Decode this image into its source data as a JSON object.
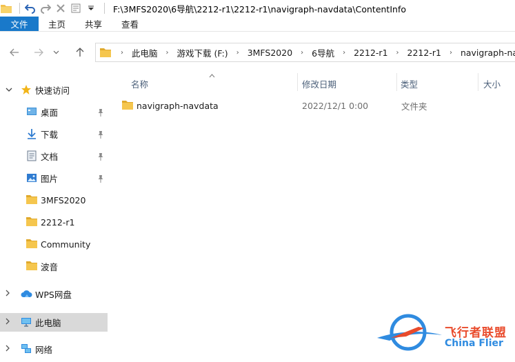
{
  "window": {
    "title": "F:\\3MFS2020\\6导航\\2212-r1\\2212-r1\\navigraph-navdata\\ContentInfo"
  },
  "ribbon": {
    "tabs": [
      "文件",
      "主页",
      "共享",
      "查看"
    ]
  },
  "address": {
    "crumbs": [
      "此电脑",
      "游戏下载 (F:)",
      "3MFS2020",
      "6导航",
      "2212-r1",
      "2212-r1",
      "navigraph-navdata"
    ]
  },
  "sidebar": {
    "quick_access": "快速访问",
    "items": [
      {
        "label": "桌面",
        "icon": "desktop-icon",
        "pinned": true
      },
      {
        "label": "下载",
        "icon": "download-icon",
        "pinned": true
      },
      {
        "label": "文档",
        "icon": "document-icon",
        "pinned": true
      },
      {
        "label": "图片",
        "icon": "picture-icon",
        "pinned": true
      },
      {
        "label": "3MFS2020",
        "icon": "folder-icon",
        "pinned": false
      },
      {
        "label": "2212-r1",
        "icon": "folder-icon",
        "pinned": false
      },
      {
        "label": "Community",
        "icon": "folder-icon",
        "pinned": false
      },
      {
        "label": "波音",
        "icon": "folder-icon",
        "pinned": false
      }
    ],
    "wps": "WPS网盘",
    "this_pc": "此电脑",
    "network": "网络"
  },
  "columns": {
    "name": "名称",
    "modified": "修改日期",
    "type": "类型",
    "size": "大小"
  },
  "files": [
    {
      "name": "navigraph-navdata",
      "modified": "2022/12/1 0:00",
      "type": "文件夹"
    }
  ],
  "watermark": {
    "cn": "飞行者联盟",
    "en": "China Flier"
  },
  "colors": {
    "accent": "#1979ca",
    "folder": "#f2c14e",
    "header_text": "#4c607a"
  }
}
